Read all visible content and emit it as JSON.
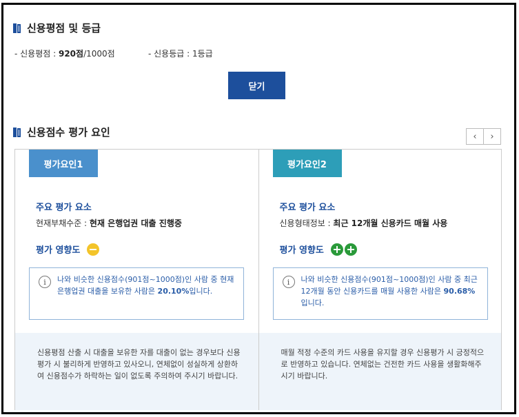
{
  "section1": {
    "title": "신용평점 및 등급"
  },
  "score": {
    "label": "- 신용평점 : ",
    "value": "920점",
    "suffix": "/1000점",
    "grade_label": "- 신용등급 : ",
    "grade_value": "1등급"
  },
  "close_button": {
    "label": "닫기"
  },
  "section2": {
    "title": "신용점수 평가 요인"
  },
  "arrows": {
    "prev": "‹",
    "next": "›"
  },
  "factors": [
    {
      "tag": "평가요인1",
      "sub_heading": "주요 평가 요소",
      "desc_label": "현재부채수준 : ",
      "desc_value": "현재 은행업권 대출 진행중",
      "impact_label": "평가 영향도",
      "info_pre": "나와 비슷한 신용점수(901점~1000점)인 사람 중 현재 은행업권 대출을 보유한 사람은 ",
      "info_bold": "20.10%",
      "info_post": "입니다.",
      "bottom_text": "신용평점 산출 시 대출을 보유한 자를 대출이 없는 경우보다 신용평가 시 불리하게 반영하고 있사오니, 연체없이 성실하게 상환하여 신용점수가 하락하는 일이 없도록 주의하여 주시기 바랍니다."
    },
    {
      "tag": "평가요인2",
      "sub_heading": "주요 평가 요소",
      "desc_label": "신용형태정보 : ",
      "desc_value": "최근 12개월 신용카드 매월 사용",
      "impact_label": "평가 영향도",
      "info_pre": "나와 비슷한 신용점수(901점~1000점)인 사람 중 최근 12개월 동안 신용카드를 매월 사용한 사람은 ",
      "info_bold": "90.68%",
      "info_post": "입니다.",
      "bottom_text": "매월 적정 수준의 카드 사용을 유지할 경우 신용평가 시 긍정적으로 반영하고 있습니다. 연체없는 건전한 카드 사용을 생활화해주시기 바랍니다."
    }
  ],
  "info_icon": "i",
  "colors": {
    "primary": "#1d4f9c",
    "tag1": "#4a90cc",
    "tag2": "#2d9eb8",
    "neutral_impact": "#f3c42a",
    "positive_impact": "#2a9a3a"
  }
}
